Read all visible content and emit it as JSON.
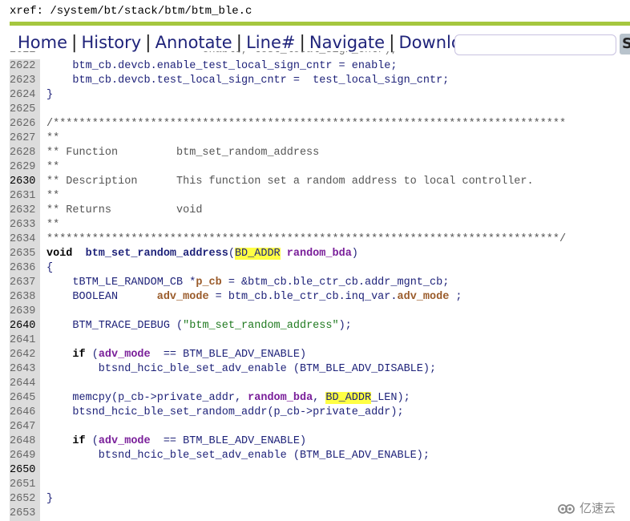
{
  "header": {
    "xref_path": "xref: /system/bt/stack/btm/btm_ble.c"
  },
  "nav": {
    "items": [
      "Home",
      "History",
      "Annotate",
      "Line#",
      "Navigate",
      "Download"
    ],
    "separator": "|",
    "search_value": "",
    "search_button_label": "S"
  },
  "colors": {
    "accent_bar": "#a5c73f",
    "nav_link": "#1f237a",
    "highlight": "#ffff44"
  },
  "code": {
    "lines": [
      {
        "n": "2621",
        "text": "                        enable, test_local_sign_cntr);"
      },
      {
        "n": "2622",
        "text": "    btm_cb.devcb.enable_test_local_sign_cntr = enable;"
      },
      {
        "n": "2623",
        "text": "    btm_cb.devcb.test_local_sign_cntr =  test_local_sign_cntr;"
      },
      {
        "n": "2624",
        "text": "}"
      },
      {
        "n": "2625",
        "text": ""
      },
      {
        "n": "2626",
        "text": "/*******************************************************************************"
      },
      {
        "n": "2627",
        "text": "**"
      },
      {
        "n": "2628",
        "text": "** Function         btm_set_random_address"
      },
      {
        "n": "2629",
        "text": "**"
      },
      {
        "n": "2630",
        "text": "** Description      This function set a random address to local controller."
      },
      {
        "n": "2631",
        "text": "**"
      },
      {
        "n": "2632",
        "text": "** Returns          void"
      },
      {
        "n": "2633",
        "text": "**"
      },
      {
        "n": "2634",
        "text": "*******************************************************************************/"
      },
      {
        "n": "2635",
        "parts": [
          [
            "kw",
            "void"
          ],
          [
            "",
            "  "
          ],
          [
            "fn",
            "btm_set_random_address"
          ],
          [
            "",
            "("
          ],
          [
            "mark",
            "BD_ADDR"
          ],
          [
            "",
            " "
          ],
          [
            "param",
            "random_bda"
          ],
          [
            "",
            ")"
          ]
        ]
      },
      {
        "n": "2636",
        "text": "{"
      },
      {
        "n": "2637",
        "parts": [
          [
            "",
            "    tBTM_LE_RANDOM_CB *"
          ],
          [
            "local",
            "p_cb"
          ],
          [
            "",
            " = &btm_cb.ble_ctr_cb.addr_mgnt_cb;"
          ]
        ]
      },
      {
        "n": "2638",
        "parts": [
          [
            "",
            "    BOOLEAN      "
          ],
          [
            "local",
            "adv_mode"
          ],
          [
            "",
            " = btm_cb.ble_ctr_cb.inq_var."
          ],
          [
            "local",
            "adv_mode"
          ],
          [
            "",
            " ;"
          ]
        ]
      },
      {
        "n": "2639",
        "text": ""
      },
      {
        "n": "2640",
        "parts": [
          [
            "",
            "    BTM_TRACE_DEBUG ("
          ],
          [
            "str",
            "\"btm_set_random_address\""
          ],
          [
            "",
            ");"
          ]
        ]
      },
      {
        "n": "2641",
        "text": ""
      },
      {
        "n": "2642",
        "parts": [
          [
            "",
            "    "
          ],
          [
            "kw",
            "if"
          ],
          [
            "",
            " ("
          ],
          [
            "param",
            "adv_mode"
          ],
          [
            "",
            "  == BTM_BLE_ADV_ENABLE)"
          ]
        ]
      },
      {
        "n": "2643",
        "text": "        btsnd_hcic_ble_set_adv_enable (BTM_BLE_ADV_DISABLE);"
      },
      {
        "n": "2644",
        "text": ""
      },
      {
        "n": "2645",
        "parts": [
          [
            "",
            "    memcpy(p_cb->private_addr, "
          ],
          [
            "param",
            "random_bda"
          ],
          [
            "",
            ", "
          ],
          [
            "mark",
            "BD_ADDR"
          ],
          [
            "",
            "_LEN);"
          ]
        ]
      },
      {
        "n": "2646",
        "text": "    btsnd_hcic_ble_set_random_addr(p_cb->private_addr);"
      },
      {
        "n": "2647",
        "text": ""
      },
      {
        "n": "2648",
        "parts": [
          [
            "",
            "    "
          ],
          [
            "kw",
            "if"
          ],
          [
            "",
            " ("
          ],
          [
            "param",
            "adv_mode"
          ],
          [
            "",
            "  == BTM_BLE_ADV_ENABLE)"
          ]
        ]
      },
      {
        "n": "2649",
        "text": "        btsnd_hcic_ble_set_adv_enable (BTM_BLE_ADV_ENABLE);"
      },
      {
        "n": "2650",
        "text": ""
      },
      {
        "n": "2651",
        "text": ""
      },
      {
        "n": "2652",
        "text": "}"
      },
      {
        "n": "2653",
        "text": ""
      }
    ],
    "highlighted_line_numbers": [
      "2630",
      "2640",
      "2650"
    ]
  },
  "watermark": {
    "icon": "cloud-logo-icon",
    "text": "亿速云"
  }
}
